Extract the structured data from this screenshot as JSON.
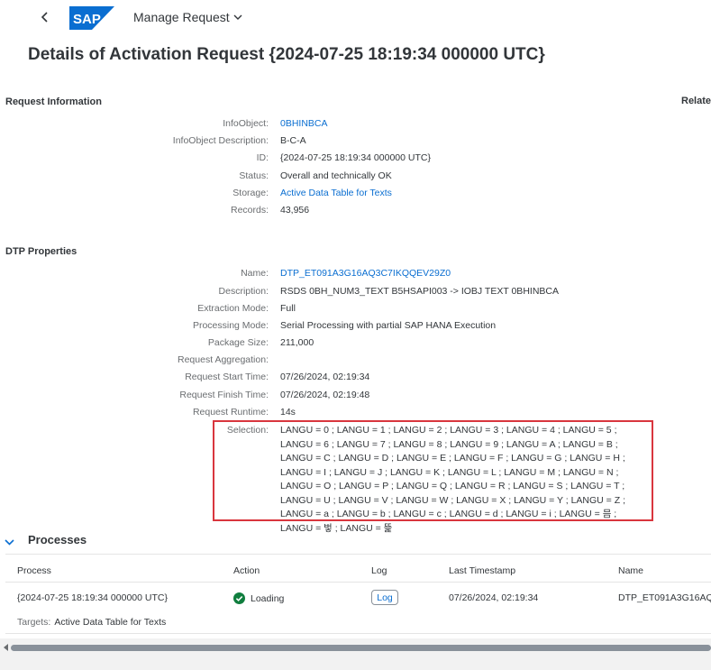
{
  "header": {
    "app_title": "Manage Request",
    "logo_text": "SAP"
  },
  "page": {
    "title": "Details of Activation Request {2024-07-25 18:19:34 000000 UTC}"
  },
  "request_info": {
    "section_title": "Request Information",
    "related_label": "Relate",
    "fields": [
      {
        "label": "InfoObject:",
        "value": "0BHINBCA"
      },
      {
        "label": "InfoObject Description:",
        "value": "B-C-A"
      },
      {
        "label": "ID:",
        "value": "{2024-07-25 18:19:34 000000 UTC}"
      },
      {
        "label": "Status:",
        "value": "Overall and technically OK"
      },
      {
        "label": "Storage:",
        "value": "Active Data Table for Texts"
      },
      {
        "label": "Records:",
        "value": "43,956"
      }
    ]
  },
  "dtp": {
    "section_title": "DTP Properties",
    "fields": [
      {
        "label": "Name:",
        "value": "DTP_ET091A3G16AQ3C7IKQQEV29Z0"
      },
      {
        "label": "Description:",
        "value": "RSDS 0BH_NUM3_TEXT B5HSAPI003 -> IOBJ TEXT 0BHINBCA"
      },
      {
        "label": "Extraction Mode:",
        "value": "Full"
      },
      {
        "label": "Processing Mode:",
        "value": "Serial Processing with partial SAP HANA Execution"
      },
      {
        "label": "Package Size:",
        "value": "211,000"
      },
      {
        "label": "Request Aggregation:",
        "value": ""
      },
      {
        "label": "Request Start Time:",
        "value": "07/26/2024, 02:19:34"
      },
      {
        "label": "Request Finish Time:",
        "value": "07/26/2024, 02:19:48"
      },
      {
        "label": "Request Runtime:",
        "value": "14s"
      }
    ],
    "selection_label": "Selection:",
    "selection_lines": [
      "LANGU = 0 ; LANGU = 1 ; LANGU = 2 ; LANGU = 3 ; LANGU = 4 ; LANGU = 5 ;",
      "LANGU = 6 ; LANGU = 7 ; LANGU = 8 ; LANGU = 9 ; LANGU = A ; LANGU = B ;",
      "LANGU = C ; LANGU = D ; LANGU = E ; LANGU = F ; LANGU = G ; LANGU = H ;",
      "LANGU = I ; LANGU = J ; LANGU = K ; LANGU = L ; LANGU = M ; LANGU = N ;",
      "LANGU = O ; LANGU = P ; LANGU = Q ; LANGU = R ; LANGU = S ; LANGU = T ;",
      "LANGU = U ; LANGU = V ; LANGU = W ; LANGU = X ; LANGU = Y ; LANGU = Z ;",
      "LANGU = a ; LANGU = b ; LANGU = c ; LANGU = d ; LANGU = i ; LANGU = 믐 ;",
      "LANGU = 벟 ; LANGU = 뜵"
    ]
  },
  "processes": {
    "title": "Processes",
    "columns": [
      "Process",
      "Action",
      "Log",
      "Last Timestamp",
      "Name"
    ],
    "row": {
      "process": "{2024-07-25 18:19:34 000000 UTC}",
      "action": "Loading",
      "log_button": "Log",
      "last_timestamp": "07/26/2024, 02:19:34",
      "name": "DTP_ET091A3G16AQ"
    },
    "targets_label": "Targets:",
    "targets_value": "Active Data Table for Texts"
  },
  "colors": {
    "link": "#0a6ed1",
    "success": "#107e3e",
    "highlight_border": "#d9363e",
    "sap_logo": "#0a6ed1"
  }
}
